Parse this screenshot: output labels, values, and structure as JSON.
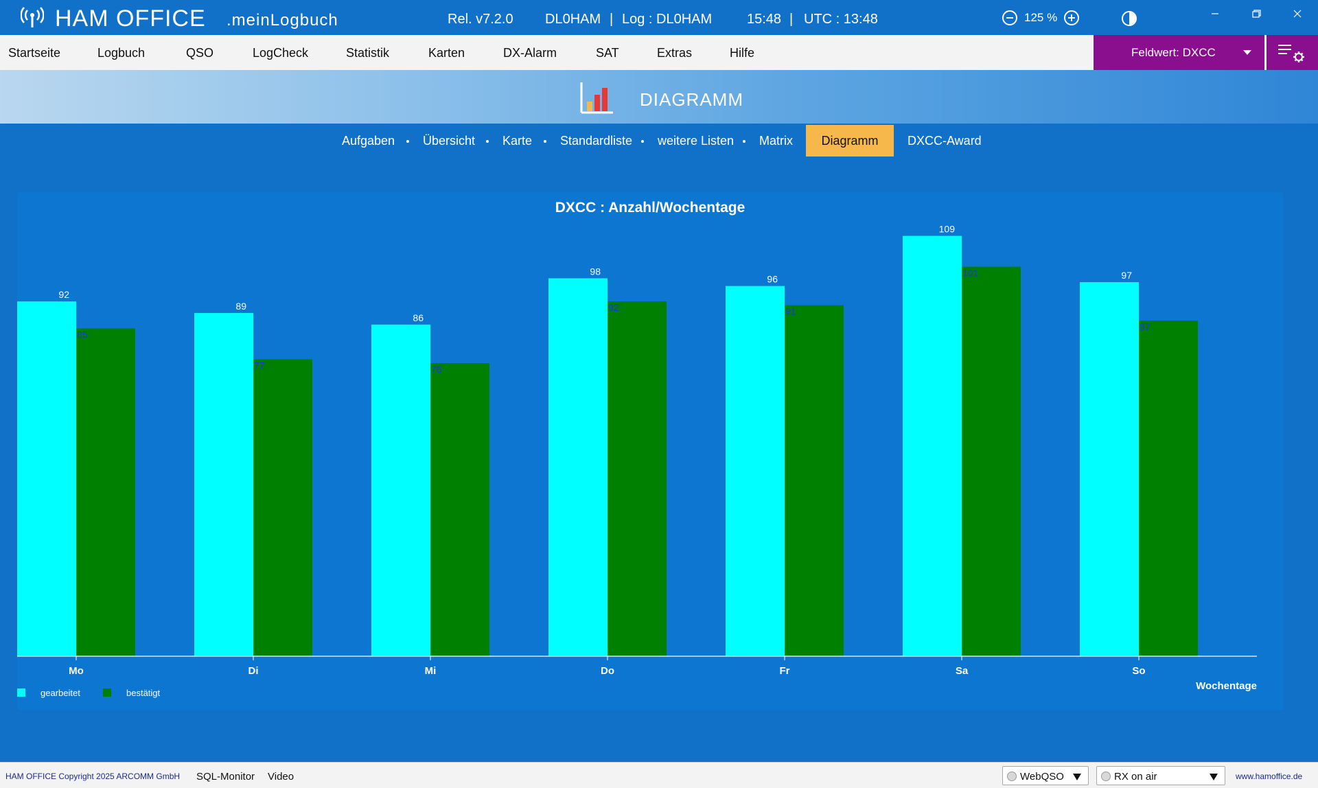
{
  "titlebar": {
    "app_name": "HAM OFFICE",
    "app_sub": ".meinLogbuch",
    "release": "Rel. v7.2.0",
    "callsign": "DL0HAM",
    "separator": "|",
    "log": "Log : DL0HAM",
    "time": "15:48",
    "utc": "UTC : 13:48",
    "zoom": "125 %"
  },
  "menu": {
    "items": [
      "Startseite",
      "Logbuch",
      "QSO",
      "LogCheck",
      "Statistik",
      "Karten",
      "DX-Alarm",
      "SAT",
      "Extras",
      "Hilfe"
    ],
    "feldwert": "Feldwert:  DXCC"
  },
  "banner": {
    "title": "DIAGRAMM"
  },
  "subnav": {
    "items": [
      "Aufgaben",
      "Übersicht",
      "Karte",
      "Standardliste",
      "weitere Listen",
      "Matrix"
    ],
    "active": "Diagramm",
    "after": "DXCC-Award"
  },
  "colors": {
    "gearbeitet": "#00ffff",
    "bestaetigt": "#008000",
    "label_gearbeitet": "#ffffff",
    "label_bestaetigt": "#1f2fff",
    "accent": "#8a0f8f",
    "active_tab": "#f7b84b"
  },
  "chart_data": {
    "type": "bar",
    "title": "DXCC : Anzahl/Wochentage",
    "xlabel": "Wochentage",
    "ylabel": "",
    "categories": [
      "Mo",
      "Di",
      "Mi",
      "Do",
      "Fr",
      "Sa",
      "So"
    ],
    "series": [
      {
        "name": "gearbeitet",
        "values": [
          92,
          89,
          86,
          98,
          96,
          109,
          97
        ]
      },
      {
        "name": "bestätigt",
        "values": [
          85,
          77,
          76,
          92,
          91,
          101,
          87
        ]
      }
    ],
    "ylim": [
      0,
      110
    ],
    "grid": false,
    "legend": "bottom-left"
  },
  "statusbar": {
    "copyright": "HAM OFFICE Copyright 2025 ARCOMM GmbH",
    "sql_monitor": "SQL-Monitor",
    "video": "Video",
    "webqso": "WebQSO",
    "rx": "RX on air",
    "website": "www.hamoffice.de"
  }
}
